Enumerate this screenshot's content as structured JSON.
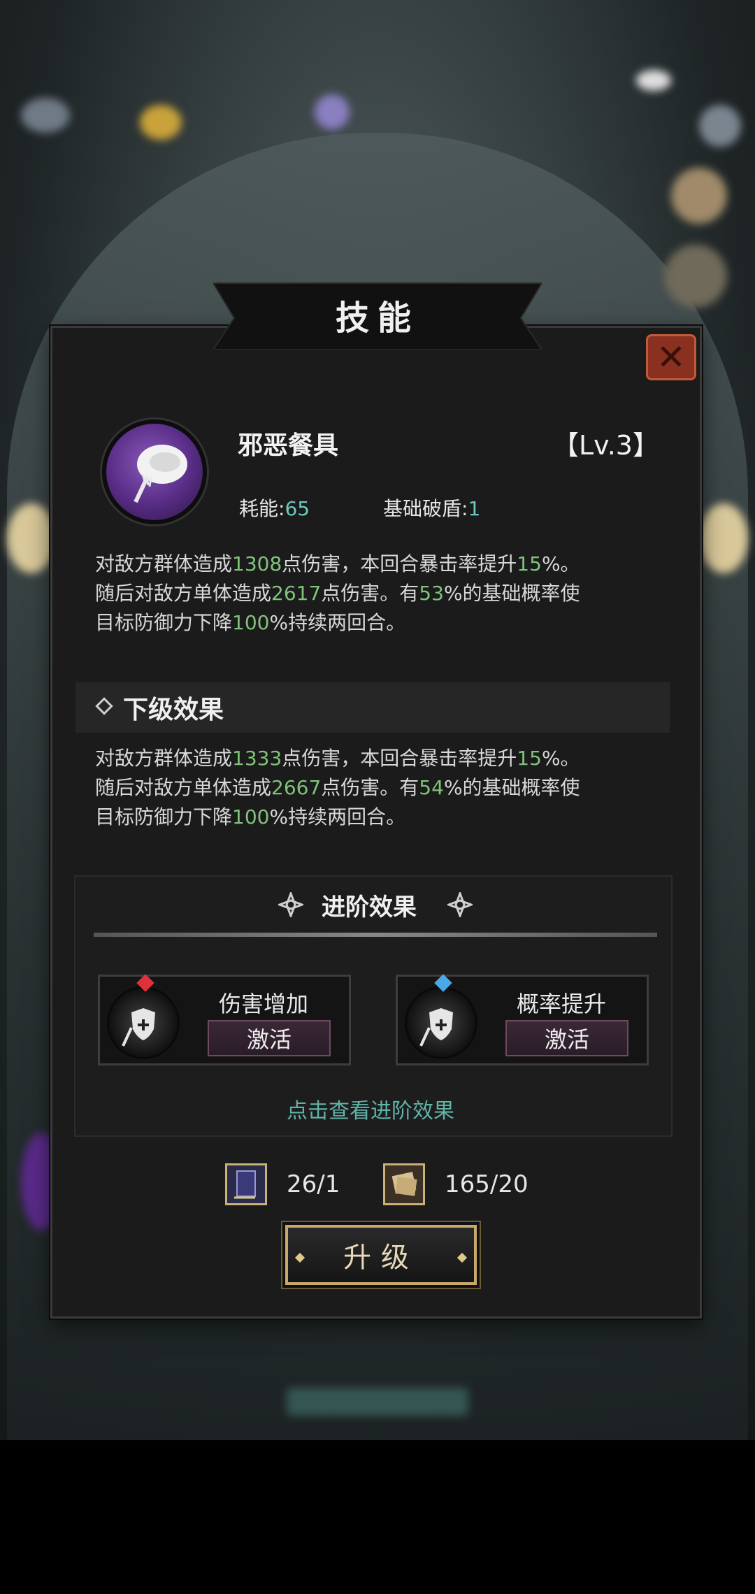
{
  "dialog": {
    "title": "技能"
  },
  "skill": {
    "name": "邪恶餐具",
    "level": "【Lv.3】",
    "cost_label": "耗能:",
    "cost_value": "65",
    "shield_label": "基础破盾:",
    "shield_value": "1",
    "desc": {
      "p1": "对敌方群体造成",
      "dmg1": "1308",
      "p2": "点伤害，本回合暴击率提升",
      "crit": "15",
      "p3": "%。",
      "p4": "随后对敌方单体造成",
      "dmg2": "2617",
      "p5": "点伤害。有",
      "chance": "53",
      "p6": "%的基础概率使",
      "p7": "目标防御力下降",
      "def": "100",
      "p8": "%持续两回合。"
    }
  },
  "next_level": {
    "title": "下级效果",
    "desc": {
      "p1": "对敌方群体造成",
      "dmg1": "1333",
      "p2": "点伤害，本回合暴击率提升",
      "crit": "15",
      "p3": "%。",
      "p4": "随后对敌方单体造成",
      "dmg2": "2667",
      "p5": "点伤害。有",
      "chance": "54",
      "p6": "%的基础概率使",
      "p7": "目标防御力下降",
      "def": "100",
      "p8": "%持续两回合。"
    }
  },
  "advanced": {
    "title": "进阶效果",
    "cards": [
      {
        "name": "伤害增加",
        "button": "激活",
        "gem_color": "#e0303a"
      },
      {
        "name": "概率提升",
        "button": "激活",
        "gem_color": "#4aa8e8"
      }
    ],
    "link": "点击查看进阶效果"
  },
  "resources": [
    {
      "icon": "skill-book-icon",
      "value": "26/1"
    },
    {
      "icon": "scroll-icon",
      "value": "165/20"
    }
  ],
  "upgrade_button": "升级",
  "colors": {
    "highlight_green": "#7fc47a",
    "cost_teal": "#6cc9c0",
    "link_teal": "#5fb3a8",
    "gold": "#c9a86a"
  }
}
